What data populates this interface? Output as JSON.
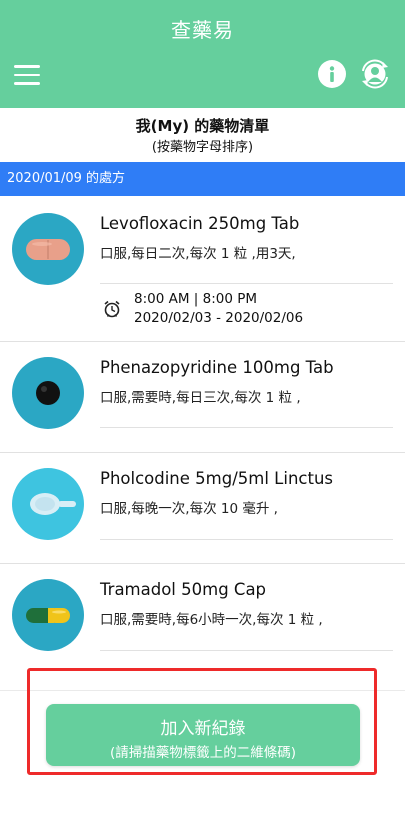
{
  "app": {
    "title": "查藥易"
  },
  "header": {
    "menu_icon": "hamburger-icon",
    "info_icon": "info-icon",
    "account_icon": "user-switch-icon",
    "background_color": "#65cf9d"
  },
  "list": {
    "title": "我(My) 的藥物清單",
    "subtitle": "(按藥物字母排序)"
  },
  "prescription": {
    "date_label": "2020/01/09 的處方",
    "bar_color": "#2f7df6"
  },
  "medications": [
    {
      "name": "Levofloxacin 250mg Tab",
      "instructions": "口服,每日二次,每次 1 粒 ,用3天,",
      "reminder_icon": "alarm-clock-icon",
      "times": "8:00 AM | 8:00 PM",
      "date_range": "2020/02/03 - 2020/02/06",
      "image": "pink-oblong-tablet"
    },
    {
      "name": "Phenazopyridine 100mg Tab",
      "instructions": "口服,需要時,每日三次,每次 1 粒 ,",
      "image": "dark-round-tablet"
    },
    {
      "name": "Pholcodine 5mg/5ml Linctus",
      "instructions": "口服,每晚一次,每次 10 毫升 ,",
      "image": "measuring-spoon"
    },
    {
      "name": "Tramadol 50mg Cap",
      "instructions": "口服,需要時,每6小時一次,每次 1 粒 ,",
      "image": "green-yellow-capsule"
    }
  ],
  "actions": {
    "add_label": "加入新紀錄",
    "add_sublabel": "(請掃描藥物標籤上的二維條碼)",
    "highlight_color": "#ee2a2a"
  }
}
